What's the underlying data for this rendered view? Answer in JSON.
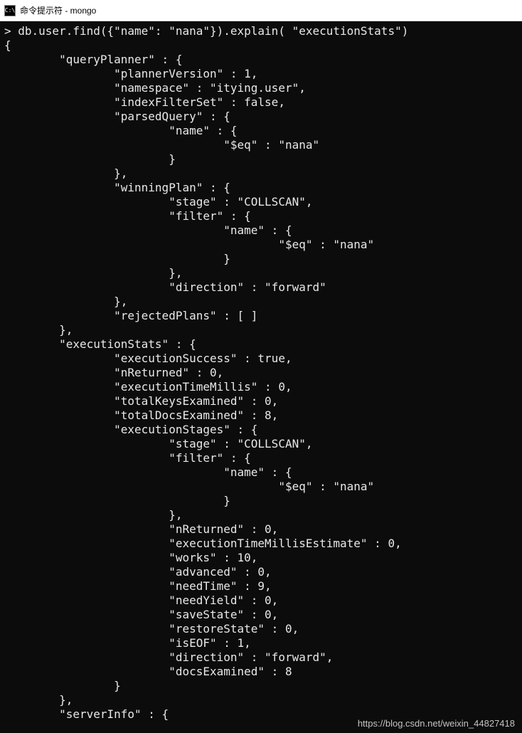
{
  "window": {
    "title": "命令提示符 - mongo"
  },
  "terminal": {
    "prompt": ">",
    "command": "db.user.find({\"name\": \"nana\"}).explain( \"executionStats\")",
    "lines": [
      "> db.user.find({\"name\": \"nana\"}).explain( \"executionStats\")",
      "{",
      "        \"queryPlanner\" : {",
      "                \"plannerVersion\" : 1,",
      "                \"namespace\" : \"itying.user\",",
      "                \"indexFilterSet\" : false,",
      "                \"parsedQuery\" : {",
      "                        \"name\" : {",
      "                                \"$eq\" : \"nana\"",
      "                        }",
      "                },",
      "                \"winningPlan\" : {",
      "                        \"stage\" : \"COLLSCAN\",",
      "                        \"filter\" : {",
      "                                \"name\" : {",
      "                                        \"$eq\" : \"nana\"",
      "                                }",
      "                        },",
      "                        \"direction\" : \"forward\"",
      "                },",
      "                \"rejectedPlans\" : [ ]",
      "        },",
      "        \"executionStats\" : {",
      "                \"executionSuccess\" : true,",
      "                \"nReturned\" : 0,",
      "                \"executionTimeMillis\" : 0,",
      "                \"totalKeysExamined\" : 0,",
      "                \"totalDocsExamined\" : 8,",
      "                \"executionStages\" : {",
      "                        \"stage\" : \"COLLSCAN\",",
      "                        \"filter\" : {",
      "                                \"name\" : {",
      "                                        \"$eq\" : \"nana\"",
      "                                }",
      "                        },",
      "                        \"nReturned\" : 0,",
      "                        \"executionTimeMillisEstimate\" : 0,",
      "                        \"works\" : 10,",
      "                        \"advanced\" : 0,",
      "                        \"needTime\" : 9,",
      "                        \"needYield\" : 0,",
      "                        \"saveState\" : 0,",
      "                        \"restoreState\" : 0,",
      "                        \"isEOF\" : 1,",
      "                        \"direction\" : \"forward\",",
      "                        \"docsExamined\" : 8",
      "                }",
      "        },",
      "        \"serverInfo\" : {"
    ]
  },
  "watermark": "https://blog.csdn.net/weixin_44827418",
  "explain_output": {
    "queryPlanner": {
      "plannerVersion": 1,
      "namespace": "itying.user",
      "indexFilterSet": false,
      "parsedQuery": {
        "name": {
          "$eq": "nana"
        }
      },
      "winningPlan": {
        "stage": "COLLSCAN",
        "filter": {
          "name": {
            "$eq": "nana"
          }
        },
        "direction": "forward"
      },
      "rejectedPlans": []
    },
    "executionStats": {
      "executionSuccess": true,
      "nReturned": 0,
      "executionTimeMillis": 0,
      "totalKeysExamined": 0,
      "totalDocsExamined": 8,
      "executionStages": {
        "stage": "COLLSCAN",
        "filter": {
          "name": {
            "$eq": "nana"
          }
        },
        "nReturned": 0,
        "executionTimeMillisEstimate": 0,
        "works": 10,
        "advanced": 0,
        "needTime": 9,
        "needYield": 0,
        "saveState": 0,
        "restoreState": 0,
        "isEOF": 1,
        "direction": "forward",
        "docsExamined": 8
      }
    }
  }
}
